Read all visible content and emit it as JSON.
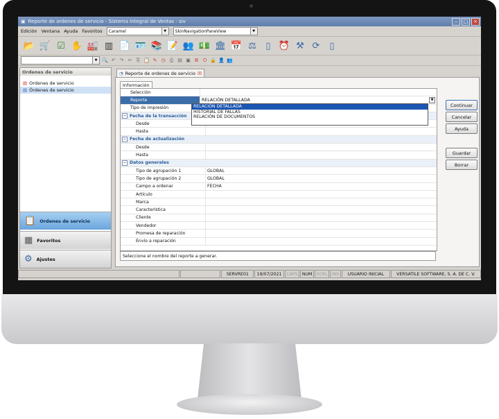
{
  "window": {
    "title": "Reporte de ordenes de servicio - Sistema Integral de Ventas - siv"
  },
  "menu": {
    "items": [
      "Edición",
      "Ventana",
      "Ayuda",
      "Favoritos"
    ],
    "theme_combo": "Caramel",
    "skin_combo": "SkinNavigationPaneView"
  },
  "nav": {
    "header": "Ordenes de servicio",
    "items": [
      "Ordenes de servicio",
      "Órdenes de servicio"
    ],
    "groups": [
      "Ordenes de servicio",
      "Favoritos",
      "Ajustes"
    ]
  },
  "document": {
    "tab_label": "Reporte de ordenes de servicio",
    "inner_tab": "Información"
  },
  "form": {
    "seleccion": "Selección",
    "reporte": {
      "label": "Reporte",
      "value": "RELACIÓN DETALLADA"
    },
    "tipo_impresion": "Tipo de impresión",
    "cat_fecha_transaccion": "Fecha de la transacción",
    "desde1": "Desde",
    "hasta1": "Hasta",
    "cat_fecha_actualizacion": "Fecha de actualización",
    "desde2": "Desde",
    "hasta2": "Hasta",
    "cat_datos_generales": "Datos generales",
    "tipo_agrup1": {
      "label": "Tipo de agrupación 1",
      "value": "GLOBAL"
    },
    "tipo_agrup2": {
      "label": "Tipo de agrupación 2",
      "value": "GLOBAL"
    },
    "campo_ordenar": {
      "label": "Campo a ordenar",
      "value": "FECHA"
    },
    "articulo": "Artículo",
    "marca": "Marca",
    "caracteristica": "Característica",
    "cliente": "Cliente",
    "vendedor": "Vendedor",
    "promesa": "Promesa de reparación",
    "envio": "Envío a reparación"
  },
  "dropdown": {
    "options": [
      "RELACIÓN DETALLADA",
      "HISTORIAL DE FALLAS",
      "RELACIÓN DE DOCUMENTOS"
    ],
    "selected": 0
  },
  "hint": "Seleccione el nombre del reporte a generar.",
  "buttons": {
    "continuar": "Continuar",
    "cancelar": "Cancelar",
    "ayuda": "Ayuda",
    "guardar": "Guardar",
    "borrar": "Borrar"
  },
  "status": {
    "server": "SERVRE01",
    "date": "19/07/2021",
    "caps": "CAPS",
    "num": "NUM",
    "scrl": "SCRL",
    "ins": "INS",
    "user": "USUARIO INICIAL",
    "company": "VERSATILE SOFTWARE, S. A. DE C. V."
  }
}
